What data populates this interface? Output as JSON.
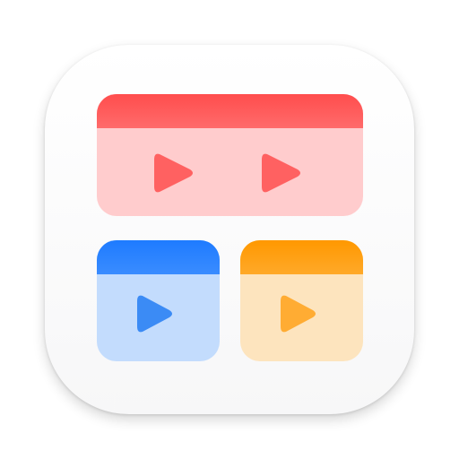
{
  "icon": {
    "tile_color": "#ffffff",
    "panels": [
      {
        "name": "panel-red",
        "bar_color": "#ff4d4d",
        "bar_color_light": "#ff6b6b",
        "body_color": "#ffcccd",
        "play_color": "#ff6161",
        "play_icons": [
          "play-icon",
          "play-icon"
        ]
      },
      {
        "name": "panel-blue",
        "bar_color": "#1e7bff",
        "bar_color_light": "#3a8cff",
        "body_color": "#c3dcfd",
        "play_color": "#3b8bf5",
        "play_icons": [
          "play-icon"
        ]
      },
      {
        "name": "panel-orange",
        "bar_color": "#ff9800",
        "bar_color_light": "#ffa929",
        "body_color": "#fde4be",
        "play_color": "#ffac33",
        "play_icons": [
          "play-icon"
        ]
      }
    ]
  }
}
